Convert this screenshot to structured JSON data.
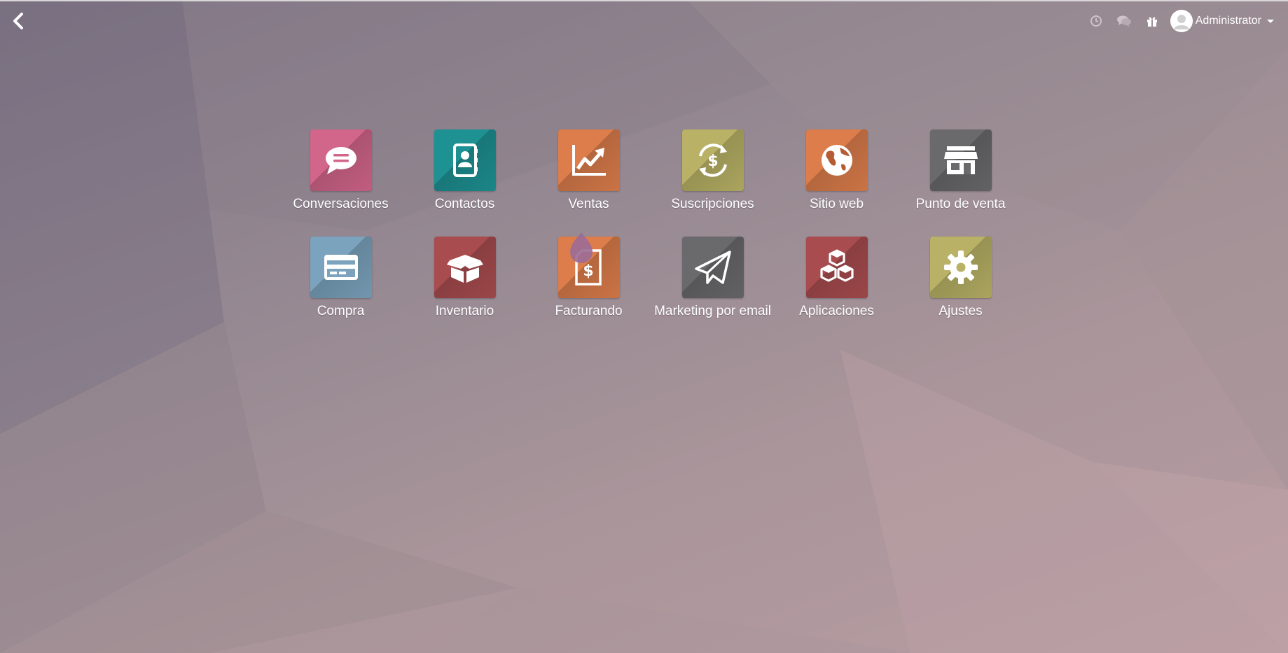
{
  "topbar": {
    "back_icon": "chevron-left-icon",
    "systray": [
      {
        "name": "activity",
        "icon": "clock-icon"
      },
      {
        "name": "discuss",
        "icon": "chat-bubbles-icon"
      },
      {
        "name": "whats-new",
        "icon": "gift-icon"
      }
    ],
    "user": {
      "name": "Administrator",
      "avatar_icon": "user-avatar-icon",
      "dropdown_icon": "caret-down-icon"
    }
  },
  "apps": [
    {
      "label": "Conversaciones",
      "icon": "chat-icon",
      "color": "#d2658a"
    },
    {
      "label": "Contactos",
      "icon": "address-book-icon",
      "color": "#1e9193"
    },
    {
      "label": "Ventas",
      "icon": "line-chart-icon",
      "color": "#dc7d4b"
    },
    {
      "label": "Suscripciones",
      "icon": "dollar-cycle-icon",
      "color": "#b9b266"
    },
    {
      "label": "Sitio web",
      "icon": "globe-icon",
      "color": "#dc7d4b"
    },
    {
      "label": "Punto de venta",
      "icon": "store-icon",
      "color": "#6a6a6c"
    },
    {
      "label": "Compra",
      "icon": "credit-card-icon",
      "color": "#7ba3bd"
    },
    {
      "label": "Inventario",
      "icon": "box-icon",
      "color": "#a84c4f"
    },
    {
      "label": "Facturando",
      "icon": "invoice-icon",
      "color": "#dc7d4b"
    },
    {
      "label": "Marketing por email",
      "icon": "paper-plane-icon",
      "color": "#6a6a6c"
    },
    {
      "label": "Aplicaciones",
      "icon": "cubes-icon",
      "color": "#a84c4f"
    },
    {
      "label": "Ajustes",
      "icon": "gear-icon",
      "color": "#b9b266"
    }
  ],
  "colors": {
    "text": "#ffffff",
    "drop_marker": "#9b6b96"
  }
}
